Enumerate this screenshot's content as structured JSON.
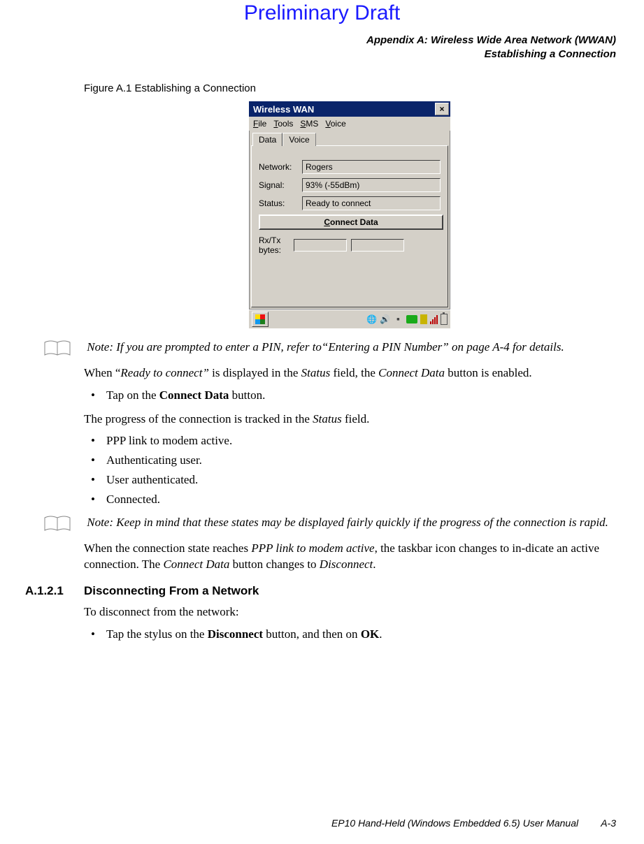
{
  "watermark": "Preliminary Draft",
  "header": {
    "l1": "Appendix A: Wireless Wide Area Network (WWAN)",
    "l2": "Establishing a Connection"
  },
  "figure_label": "Figure A.1  Establishing a Connection",
  "win": {
    "title": "Wireless WAN",
    "menu": {
      "file": "File",
      "tools": "Tools",
      "sms": "SMS",
      "voice": "Voice"
    },
    "tabs": {
      "data": "Data",
      "voice": "Voice"
    },
    "labels": {
      "network": "Network:",
      "signal": "Signal:",
      "status": "Status:",
      "rxtx": "Rx/Tx\nbytes:"
    },
    "values": {
      "network": "Rogers",
      "signal": "93% (-55dBm)",
      "status": "Ready to connect"
    },
    "connect_btn": "Connect Data"
  },
  "note1": "Note: If you are prompted to enter a PIN, refer to“Entering a PIN Number” on page A-4 for details.",
  "para1a": "When “",
  "para1b": "Ready to connect”",
  "para1c": " is displayed in the ",
  "para1d": "Status",
  "para1e": " field, the ",
  "para1f": "Connect Data",
  "para1g": " button is enabled.",
  "bullet1": "Tap on the ",
  "bullet1b": "Connect Data",
  "bullet1c": " button.",
  "para2a": "The progress of the connection is tracked in the ",
  "para2b": "Status",
  "para2c": " field.",
  "steps": [
    "PPP link to modem active.",
    "Authenticating user.",
    "User authenticated.",
    "Connected."
  ],
  "note2": "Note: Keep in mind that these states may be displayed fairly quickly if the progress of the connection is rapid.",
  "para3a": "When the connection state reaches ",
  "para3b": "PPP link to modem active",
  "para3c": ", the taskbar icon changes to in-dicate an active connection. The ",
  "para3d": "Connect Data",
  "para3e": " button changes to ",
  "para3f": "Disconnect",
  "para3g": ".",
  "section": {
    "num": "A.1.2.1",
    "title": "Disconnecting From a Network"
  },
  "para4": "To disconnect from the network:",
  "bullet2a": "Tap the stylus on the ",
  "bullet2b": "Disconnect",
  "bullet2c": " button, and then on ",
  "bullet2d": "OK",
  "bullet2e": ".",
  "footer": {
    "txt": "EP10 Hand-Held (Windows Embedded 6.5) User Manual",
    "page": "A-3"
  }
}
